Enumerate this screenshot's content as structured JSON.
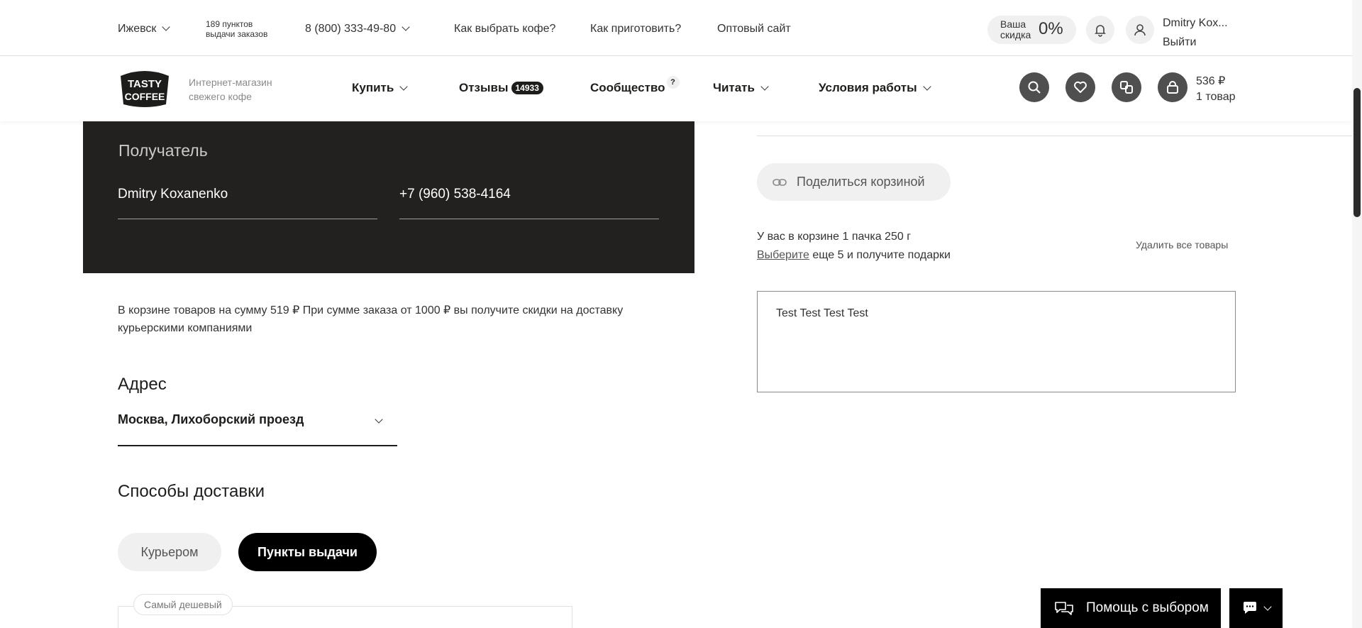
{
  "topbar": {
    "city": "Ижевск",
    "pickup_points": "189 пунктов",
    "pickup_points_sub": "выдачи заказов",
    "phone": "8 (800) 333-49-80",
    "links": [
      "Как выбрать кофе?",
      "Как приготовить?",
      "Оптовый сайт"
    ],
    "discount_label_1": "Ваша",
    "discount_label_2": "скидка",
    "discount_value": "0%",
    "user_name": "Dmitry Kox...",
    "logout": "Выйти"
  },
  "header": {
    "logo_line1": "TASTY",
    "logo_line2": "COFFEE",
    "tagline_1": "Интернет-магазин",
    "tagline_2": "свежего кофе",
    "nav": {
      "buy": "Купить",
      "reviews": "Отзывы",
      "reviews_count": "14933",
      "community": "Сообщество",
      "community_hint": "?",
      "read": "Читать",
      "terms": "Условия работы"
    },
    "cart_total": "536 ₽",
    "cart_count": "1 товар"
  },
  "recipient": {
    "title": "Получатель",
    "name": "Dmitry Koxanenko",
    "phone": "+7 (960) 538-4164"
  },
  "notice": "В корзине товаров на сумму 519 ₽ При сумме заказа от 1000 ₽ вы получите скидки на доставку курьерскими компаниями",
  "address": {
    "title": "Адрес",
    "value": "Москва, Лихоборский проезд"
  },
  "delivery": {
    "title": "Способы доставки",
    "options": [
      "Курьером",
      "Пункты выдачи"
    ],
    "selected": "Пункты выдачи",
    "cheapest_tag": "Самый дешевый"
  },
  "cart_panel": {
    "share_label": "Поделиться корзиной",
    "cart_line": "У вас в корзине 1 пачка 250 г",
    "choose_link": "Выберите",
    "choose_rest": " еще 5 и получите подарки",
    "delete_all": "Удалить все товары",
    "comment": "Test Test Test Test"
  },
  "widgets": {
    "help": "Помощь с выбором"
  },
  "colors": {
    "dark_block": "#232120",
    "icon_circle": "#4f4f4f",
    "accent_black": "#000000",
    "light_pill": "#f0f0f0"
  }
}
